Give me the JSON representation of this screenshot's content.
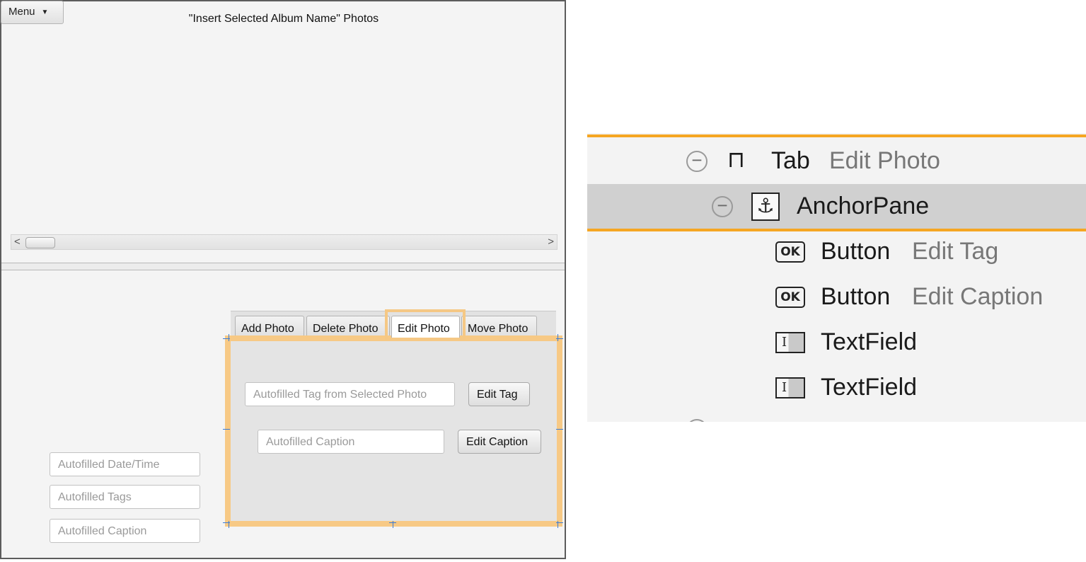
{
  "preview": {
    "menu_label": "Menu",
    "album_title": "\"Insert Selected Album Name\" Photos",
    "scroll_left": "<",
    "scroll_right": ">",
    "left_fields": {
      "datetime_placeholder": "Autofilled Date/Time",
      "tags_placeholder": "Autofilled Tags",
      "caption_placeholder": "Autofilled Caption"
    },
    "tabs": [
      {
        "label": "Add Photo"
      },
      {
        "label": "Delete Photo"
      },
      {
        "label": "Edit Photo",
        "selected": true
      },
      {
        "label": "Move Photo"
      }
    ],
    "edit_photo": {
      "tag_placeholder": "Autofilled Tag from Selected Photo",
      "edit_tag_label": "Edit Tag",
      "caption_placeholder": "Autofilled Caption",
      "edit_caption_label": "Edit Caption"
    }
  },
  "hierarchy": {
    "rows": [
      {
        "type": "Tab",
        "name": "Edit Photo",
        "icon": "tab-icon"
      },
      {
        "type": "AnchorPane",
        "name": "",
        "icon": "anchor-icon",
        "selected": true
      },
      {
        "type": "Button",
        "name": "Edit Tag",
        "icon": "ok-button-icon"
      },
      {
        "type": "Button",
        "name": "Edit Caption",
        "icon": "ok-button-icon"
      },
      {
        "type": "TextField",
        "name": "",
        "icon": "textfield-icon"
      },
      {
        "type": "TextField",
        "name": "",
        "icon": "textfield-icon"
      }
    ],
    "collapse_glyph": "−",
    "ok_glyph": "OK",
    "textfield_glyph": "I",
    "anchor_glyph": "⚓",
    "tab_glyph": "⊓",
    "highlight_color": "#f5a623"
  }
}
